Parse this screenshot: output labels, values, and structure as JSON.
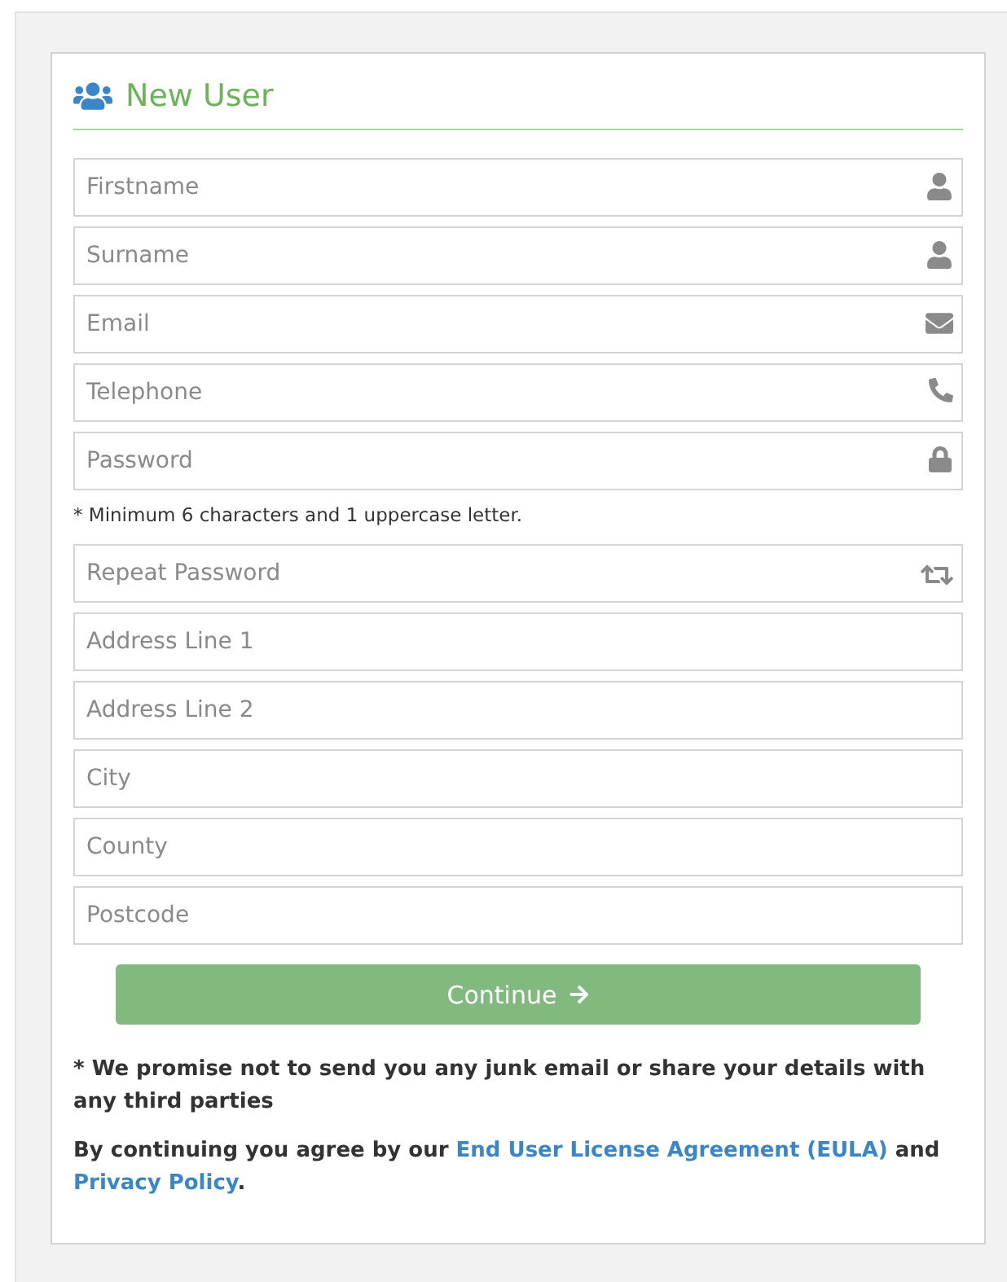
{
  "form": {
    "title": "New User",
    "fields": [
      {
        "kind": "person",
        "placeholder": "Firstname"
      },
      {
        "kind": "person",
        "placeholder": "Surname"
      },
      {
        "kind": "email",
        "placeholder": "Email"
      },
      {
        "kind": "phone",
        "placeholder": "Telephone"
      },
      {
        "kind": "password",
        "placeholder": "Password",
        "note": "* Minimum 6 characters and 1 uppercase letter."
      },
      {
        "kind": "repeat",
        "placeholder": "Repeat Password"
      },
      {
        "kind": "plain",
        "placeholder": "Address Line 1"
      },
      {
        "kind": "plain",
        "placeholder": "Address Line 2"
      },
      {
        "kind": "plain",
        "placeholder": "City"
      },
      {
        "kind": "plain",
        "placeholder": "County"
      },
      {
        "kind": "plain",
        "placeholder": "Postcode"
      }
    ],
    "submit": {
      "label": "Continue"
    },
    "notice": "* We promise not to send you any junk email or share your details with any third parties",
    "agreement": [
      {
        "kind": "text",
        "text": "By continuing you agree by our "
      },
      {
        "kind": "link",
        "text": "End User License Agreement (EULA)"
      },
      {
        "kind": "text",
        "text": " and "
      },
      {
        "kind": "link",
        "text": "Privacy Policy"
      },
      {
        "kind": "text",
        "text": "."
      }
    ]
  }
}
